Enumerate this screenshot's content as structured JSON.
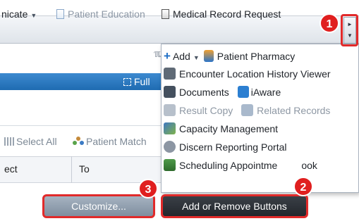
{
  "toolbar": {
    "communicate_label": "nicate",
    "patient_education_label": "Patient Education",
    "medical_record_request_label": "Medical Record Request"
  },
  "banner": {
    "full_label": "Full"
  },
  "selection_bar": {
    "select_all_label": "Select All",
    "patient_match_label": "Patient Match"
  },
  "grid": {
    "col_subject": "ect",
    "col_to": "To"
  },
  "buttons": {
    "customize_label": "Customize...",
    "add_remove_label": "Add or Remove Buttons"
  },
  "menu": {
    "add_label": "Add",
    "patient_pharmacy_label": "Patient Pharmacy",
    "encounter_location_label": "Encounter Location History Viewer",
    "documents_label": "Documents",
    "iaware_label": "iAware",
    "result_copy_label": "Result Copy",
    "related_records_label": "Related Records",
    "capacity_management_label": "Capacity Management",
    "discern_reporting_label": "Discern Reporting Portal",
    "scheduling_label": "Scheduling Appointme",
    "scheduling_tail": "ook"
  },
  "callouts": {
    "one": "1",
    "two": "2",
    "three": "3"
  },
  "colors": {
    "callout_red": "#e01f1f",
    "banner_blue": "#2a78c0"
  }
}
